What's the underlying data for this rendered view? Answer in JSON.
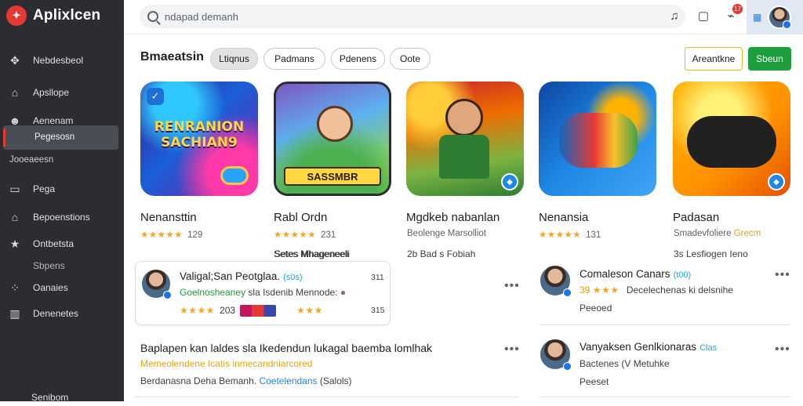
{
  "app": {
    "name": "Aplixlcen"
  },
  "sidebar": {
    "items": [
      {
        "label": "Nebdesbeol",
        "icon": "gamepad-icon"
      },
      {
        "label": "Apsllope",
        "icon": "home-icon"
      },
      {
        "label": "Aenenam",
        "icon": "user-group-icon"
      },
      {
        "label": "Pega",
        "icon": "page-icon"
      },
      {
        "label": "Bepoenstions",
        "icon": "home-alt-icon"
      },
      {
        "label": "Ontbetsta",
        "icon": "star-icon"
      },
      {
        "label": "Sbpens",
        "icon": "none"
      },
      {
        "label": "Oanaies",
        "icon": "network-icon"
      },
      {
        "label": "Denenetes",
        "icon": "chart-icon"
      }
    ],
    "active_sub": "Pegesosn",
    "heading": "Jooeaeesn",
    "footer": "Senibom"
  },
  "topbar": {
    "search_placeholder": "ndapad demanh",
    "notif_count": "17"
  },
  "filters": {
    "title": "Bmaeatsin",
    "chips": [
      "Ltiqnus",
      "Padmans",
      "Pdenens",
      "Oote"
    ],
    "outline_button": "Areantkne",
    "primary_button": "Sbeun"
  },
  "apps": [
    {
      "name": "Nenansttin",
      "rating": "129",
      "meta": "Setes Mhageneeli",
      "art": "RENRANION SACHIAN9"
    },
    {
      "name": "Rabl Ordn",
      "rating": "231",
      "meta": "Beolenge Marsolliot",
      "art": "SASSMBR"
    },
    {
      "name": "Mgdkeb nabanlan",
      "rating": "Beolenge Marsolliot",
      "meta": "2b Bad s Fobiah",
      "meta_accent": "Fobiah",
      "art": ""
    },
    {
      "name": "Nenansia",
      "rating": "131",
      "meta": "",
      "art": ""
    },
    {
      "name": "Padasan",
      "rating": "Smadevfoliere",
      "rating_accent": "Grecm",
      "meta": "3s Lesfiogen Ieno",
      "art": ""
    }
  ],
  "list_items": [
    {
      "title": "Valigal;San Peotglaa.",
      "tag": "(s0s)",
      "sub_green": "Goelnosheaney",
      "sub_rest": "sla Isdenib Mennode:",
      "rating_value": "203",
      "num_top": "311",
      "num_bottom": "315"
    },
    {
      "title": "Comaleson Canars",
      "tag": "(t00)",
      "sub_rating": "39",
      "sub_rest": "Decelechenas ki delsnihe",
      "meta": "Peeoed"
    },
    {
      "title": "Baplapen kan laldes sla Ikedendun lukagal baemba lomlhak",
      "sub_orange": "Memeolendene Icatis inmecandniarcored",
      "sub_rest": "Berdanasna Deha Bemanh.",
      "sub_blue": "Coetelendans",
      "sub_tail": "(Salols)"
    },
    {
      "title": "Vanyaksen Genlkionaras",
      "tag": "Clas",
      "sub_rest": "Bactenes (V Metuhke",
      "meta": "Peeset"
    }
  ],
  "colors": {
    "brand": "#e53935",
    "primary": "#1e9e3e",
    "accent_outline": "#e8b923",
    "sidebar": "#2b2d31"
  }
}
